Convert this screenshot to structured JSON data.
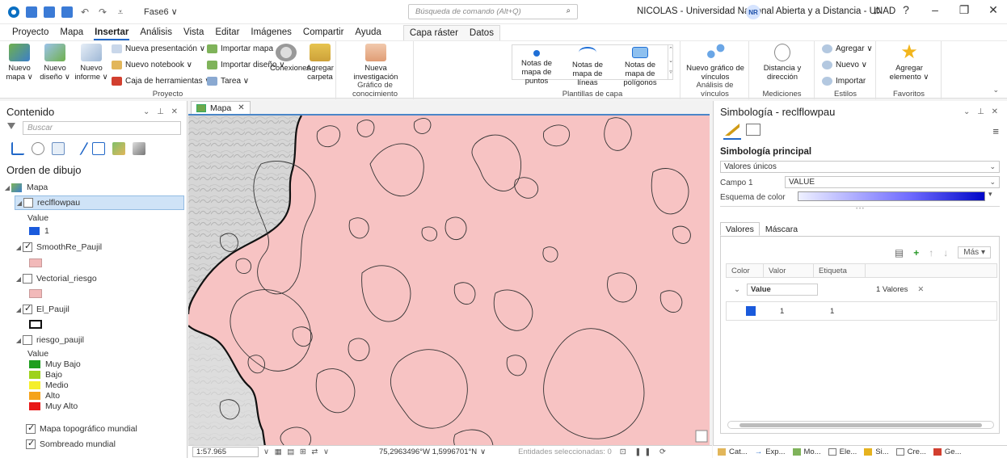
{
  "titlebar": {
    "project_name": "Fase6 ∨",
    "command_search": "Búsqueda de comando (Alt+Q)",
    "window_title": "NICOLAS - Universidad Nacional Abierta y a Distancia - UNAD",
    "user_initials": "NR"
  },
  "menu": {
    "tabs": [
      "Proyecto",
      "Mapa",
      "Insertar",
      "Análisis",
      "Vista",
      "Editar",
      "Imágenes",
      "Compartir",
      "Ayuda"
    ],
    "active": "Insertar",
    "context_tabs": [
      "Capa ráster",
      "Datos"
    ]
  },
  "ribbon": {
    "proyecto": {
      "label": "Proyecto",
      "nuevo_mapa": "Nuevo mapa ∨",
      "nuevo_diseno": "Nuevo diseño ∨",
      "nuevo_informe": "Nuevo informe ∨",
      "nueva_presentacion": "Nueva presentación ∨",
      "nuevo_notebook": "Nuevo notebook ∨",
      "caja_herramientas": "Caja de herramientas ∨",
      "importar_mapa": "Importar mapa",
      "importar_diseno": "Importar diseño ∨",
      "tarea": "Tarea ∨",
      "conexiones": "Conexiones",
      "agregar_carpeta": "Agregar carpeta"
    },
    "grafico": {
      "label": "Gráfico de conocimiento",
      "nueva_investigacion": "Nueva investigación"
    },
    "plantillas": {
      "label": "Plantillas de capa",
      "notas_puntos": "Notas de mapa de puntos",
      "notas_lineas": "Notas de mapa de líneas",
      "notas_poligonos": "Notas de mapa de polígonos"
    },
    "analisis": {
      "label": "Análisis de vínculos",
      "nuevo_grafico": "Nuevo gráfico de vínculos"
    },
    "mediciones": {
      "label": "Mediciones",
      "distancia": "Distancia y dirección"
    },
    "estilos": {
      "label": "Estilos",
      "agregar": "Agregar ∨",
      "nuevo": "Nuevo ∨",
      "importar": "Importar"
    },
    "favoritos": {
      "label": "Favoritos",
      "agregar_elemento": "Agregar elemento ∨"
    }
  },
  "contents": {
    "title": "Contenido",
    "search_placeholder": "Buscar",
    "section_title": "Orden de dibujo",
    "map_name": "Mapa",
    "layers": [
      {
        "name": "reclflowpau",
        "checked": false,
        "selected": true,
        "legend_title": "Value",
        "legend": [
          {
            "label": "1",
            "color": "#1a5adc"
          }
        ]
      },
      {
        "name": "SmoothRe_Paujil",
        "checked": true,
        "swatch": "#f2b9b9"
      },
      {
        "name": "Vectorial_riesgo",
        "checked": false,
        "swatch": "#f2b9b9"
      },
      {
        "name": "El_Paujil",
        "checked": true,
        "swatch": "outline"
      },
      {
        "name": "riesgo_paujil",
        "checked": false,
        "legend_title": "Value",
        "legend": [
          {
            "label": "Muy Bajo",
            "color": "#1e9e1e"
          },
          {
            "label": "Bajo",
            "color": "#9ed21c"
          },
          {
            "label": "Medio",
            "color": "#f5ef2a"
          },
          {
            "label": "Alto",
            "color": "#f5a31b"
          },
          {
            "label": "Muy Alto",
            "color": "#e81818"
          }
        ]
      },
      {
        "name": "Mapa topográfico mundial",
        "checked": true
      },
      {
        "name": "Sombreado mundial",
        "checked": true
      }
    ]
  },
  "map": {
    "tab_label": "Mapa",
    "scale": "1:57.965",
    "coordinates": "75,2963496°W 1,5996701°N",
    "selected_features": "Entidades seleccionadas: 0"
  },
  "symbology": {
    "title": "Simbología - reclflowpau",
    "primary_label": "Simbología principal",
    "method": "Valores únicos",
    "field_label": "Campo 1",
    "field_value": "VALUE",
    "ramp_label": "Esquema de color",
    "tabs": [
      "Valores",
      "Máscara"
    ],
    "mas_button": "Más",
    "columns": [
      "Color",
      "Valor",
      "Etiqueta"
    ],
    "group_name": "Value",
    "group_count": "1 Valores",
    "rows": [
      {
        "color": "#1a5adc",
        "value": "1",
        "label": "1"
      }
    ]
  },
  "bottom_tabs": [
    "Cat...",
    "Exp...",
    "Mo...",
    "Ele...",
    "Si...",
    "Cre...",
    "Ge..."
  ],
  "colors": {
    "accent": "#2268c8",
    "map_fill": "#f7c3c3",
    "terrain": "#d9d9d9"
  }
}
